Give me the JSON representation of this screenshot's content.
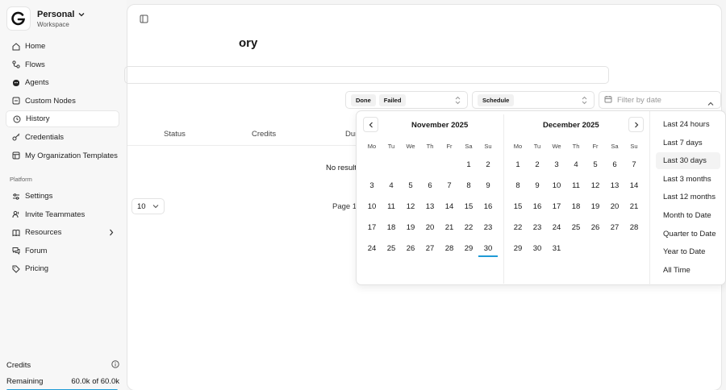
{
  "workspace": {
    "name": "Personal",
    "subtitle": "Workspace"
  },
  "sidebar": {
    "items": [
      {
        "label": "Home",
        "icon": "home-icon"
      },
      {
        "label": "Flows",
        "icon": "flows-icon"
      },
      {
        "label": "Agents",
        "icon": "agents-icon"
      },
      {
        "label": "Custom Nodes",
        "icon": "custom-nodes-icon"
      },
      {
        "label": "History",
        "icon": "history-icon",
        "active": true
      },
      {
        "label": "Credentials",
        "icon": "key-icon"
      },
      {
        "label": "My Organization Templates",
        "icon": "templates-icon"
      }
    ],
    "section_label": "Platform",
    "platform_items": [
      {
        "label": "Settings",
        "icon": "settings-icon"
      },
      {
        "label": "Invite Teammates",
        "icon": "users-icon"
      },
      {
        "label": "Resources",
        "icon": "book-icon"
      },
      {
        "label": "Forum",
        "icon": "chat-icon"
      },
      {
        "label": "Pricing",
        "icon": "tag-icon"
      }
    ],
    "credits": {
      "title": "Credits",
      "remaining_label": "Remaining",
      "remaining_value": "60.0k of 60.0k",
      "fraction": 1.0
    }
  },
  "page": {
    "title": "ory"
  },
  "filters": {
    "status_chips": [
      "Done",
      "Failed"
    ],
    "type_chips": [
      "Schedule"
    ],
    "date_placeholder": "Filter by date"
  },
  "table": {
    "headers": [
      "Status",
      "Credits",
      "Dur"
    ],
    "empty_text": "No results",
    "rows_per_page": "10",
    "page_indicator": "Page 1"
  },
  "calendar": {
    "weekdays": [
      "Mo",
      "Tu",
      "We",
      "Th",
      "Fr",
      "Sa",
      "Su"
    ],
    "left": {
      "title": "November 2025",
      "weeks": [
        [
          "",
          "",
          "",
          "",
          "",
          "1",
          "2"
        ],
        [
          "3",
          "4",
          "5",
          "6",
          "7",
          "8",
          "9"
        ],
        [
          "10",
          "11",
          "12",
          "13",
          "14",
          "15",
          "16"
        ],
        [
          "17",
          "18",
          "19",
          "20",
          "21",
          "22",
          "23"
        ],
        [
          "24",
          "25",
          "26",
          "27",
          "28",
          "29",
          "30"
        ]
      ]
    },
    "right": {
      "title": "December 2025",
      "weeks": [
        [
          "1",
          "2",
          "3",
          "4",
          "5",
          "6",
          "7"
        ],
        [
          "8",
          "9",
          "10",
          "11",
          "12",
          "13",
          "14"
        ],
        [
          "15",
          "16",
          "17",
          "18",
          "19",
          "20",
          "21"
        ],
        [
          "22",
          "23",
          "24",
          "25",
          "26",
          "27",
          "28"
        ],
        [
          "29",
          "30",
          "31",
          "",
          "",
          "",
          ""
        ]
      ]
    },
    "today": "30",
    "presets": [
      "Last 24 hours",
      "Last 7 days",
      "Last 30 days",
      "Last 3 months",
      "Last 12 months",
      "Month to Date",
      "Quarter to Date",
      "Year to Date",
      "All Time"
    ],
    "selected_preset": "Last 30 days"
  },
  "colors": {
    "accent": "#1f9bd6",
    "text": "#171717",
    "border": "#e3e3e3"
  }
}
